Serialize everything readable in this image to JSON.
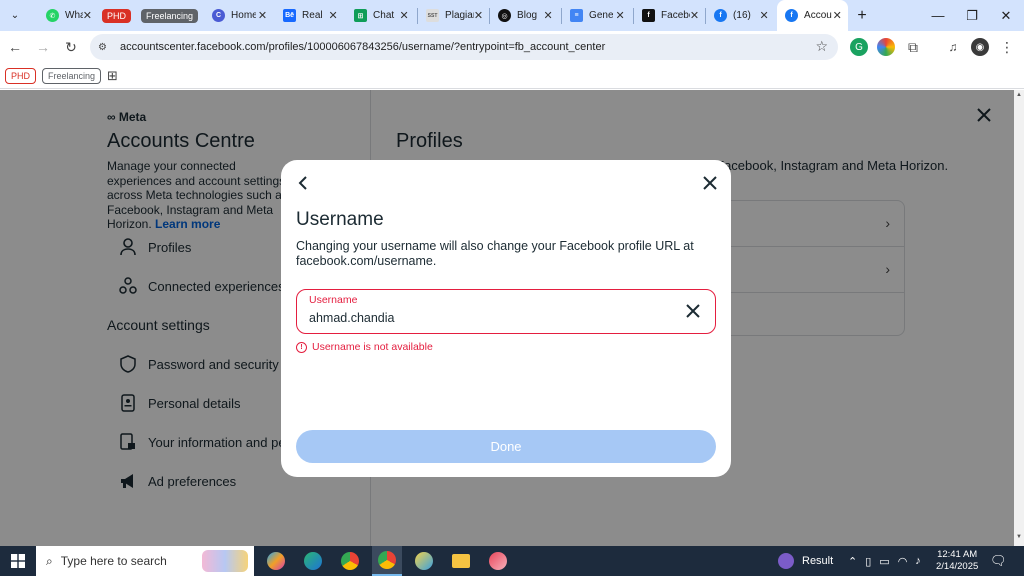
{
  "tabs": [
    {
      "title": "WhatsApp",
      "favicon_color": "#25d366",
      "favicon_text": "✆"
    },
    {
      "title": "Home",
      "favicon_color": "#4a5bd4",
      "favicon_text": "C"
    },
    {
      "title": "Real",
      "favicon_color": "#1769ff",
      "favicon_text": "Bē"
    },
    {
      "title": "Chat",
      "favicon_color": "#0f9d58",
      "favicon_text": "⊞"
    },
    {
      "title": "Plagiarism",
      "favicon_color": "#cccccc",
      "favicon_text": "SST"
    },
    {
      "title": "Blog",
      "favicon_color": "#111111",
      "favicon_text": "◎"
    },
    {
      "title": "Gene",
      "favicon_color": "#4285f4",
      "favicon_text": "≡"
    },
    {
      "title": "Facebook",
      "favicon_color": "#111111",
      "favicon_text": "f"
    },
    {
      "title": "(16)",
      "favicon_color": "#1877f2",
      "favicon_text": "f"
    },
    {
      "title": "Accounts",
      "favicon_color": "#1877f2",
      "favicon_text": "f"
    }
  ],
  "tab_groups": {
    "phd": "PHD",
    "freelancing": "Freelancing"
  },
  "address_bar": {
    "url": "accountscenter.facebook.com/profiles/100006067843256/username/?entrypoint=fb_account_center"
  },
  "bookmarks": {
    "phd": "PHD",
    "freelancing": "Freelancing"
  },
  "sidebar": {
    "logo": "∞ Meta",
    "title": "Accounts Centre",
    "description": "Manage your connected experiences and account settings across Meta technologies such as Facebook, Instagram and Meta Horizon.",
    "learn_more": "Learn more",
    "items": [
      {
        "label": "Profiles",
        "icon": "person-icon"
      },
      {
        "label": "Connected experiences",
        "icon": "connected-icon"
      }
    ],
    "account_settings_title": "Account settings",
    "settings_items": [
      {
        "label": "Password and security",
        "icon": "shield-icon"
      },
      {
        "label": "Personal details",
        "icon": "id-card-icon"
      },
      {
        "label": "Your information and permissions",
        "icon": "info-lock-icon"
      },
      {
        "label": "Ad preferences",
        "icon": "megaphone-icon"
      }
    ]
  },
  "main": {
    "title": "Profiles",
    "subtitle": "Manage your profile info, and use the same info across Facebook, Instagram and Meta Horizon."
  },
  "modal": {
    "title": "Username",
    "description": "Changing your username will also change your Facebook profile URL at facebook.com/username.",
    "field_label": "Username",
    "field_value": "ahmad.chandia",
    "error": "Username is not available",
    "done_label": "Done"
  },
  "taskbar": {
    "search_placeholder": "Type here to search",
    "weather_label": "Result",
    "time": "12:41 AM",
    "date": "2/14/2025"
  },
  "colors": {
    "error": "#e41e3f",
    "brand": "#0064e0",
    "done_disabled": "#a6c8f5"
  }
}
